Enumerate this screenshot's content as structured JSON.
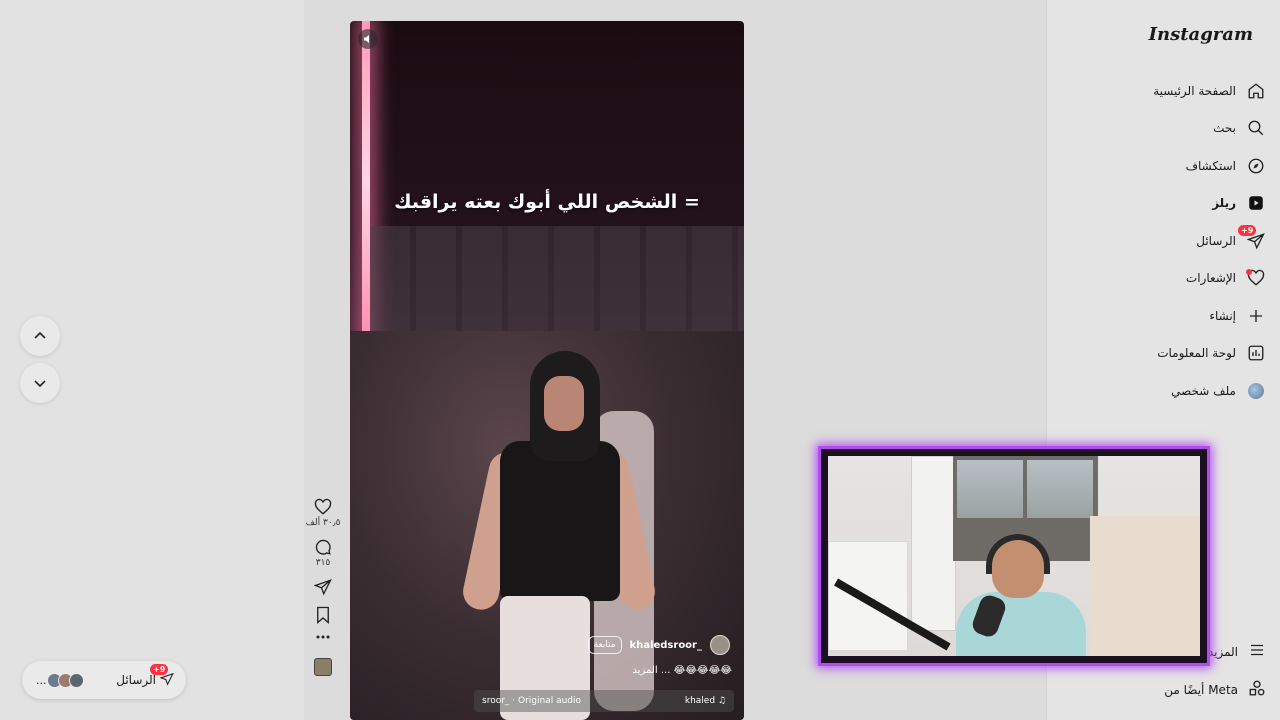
{
  "sidebar": {
    "logo": "Instagram",
    "items": [
      {
        "label": "الصفحة الرئيسية",
        "icon": "home-icon"
      },
      {
        "label": "بحث",
        "icon": "search-icon"
      },
      {
        "label": "استكشاف",
        "icon": "compass-icon"
      },
      {
        "label": "ريلز",
        "icon": "reels-icon"
      },
      {
        "label": "الرسائل",
        "icon": "messages-icon",
        "badge": "+9"
      },
      {
        "label": "الإشعارات",
        "icon": "heart-icon"
      },
      {
        "label": "إنشاء",
        "icon": "plus-icon"
      },
      {
        "label": "لوحة المعلومات",
        "icon": "dashboard-icon"
      },
      {
        "label": "ملف شخصي",
        "icon": "profile-avatar"
      }
    ],
    "more_label": "المزيد",
    "meta_label": "أيضًا من Meta"
  },
  "reel": {
    "overlay_text": "= الشخص اللي أبوك بعته يراقبك",
    "username": "khaledsroor_",
    "follow_label": "متابعة",
    "caption": "😂😂😂😂😂 ... المزيد",
    "audio_left": "sroor_ · Original audio",
    "audio_right": "khaled ♫"
  },
  "actions": {
    "likes": "٣٠٫٥ ألف",
    "comments": "٣١٥"
  },
  "messages_pill": {
    "label": "الرسائل",
    "badge": "+9",
    "more": "..."
  },
  "colors": {
    "accent": "#ff3040",
    "cam_border": "#b14cf0"
  }
}
